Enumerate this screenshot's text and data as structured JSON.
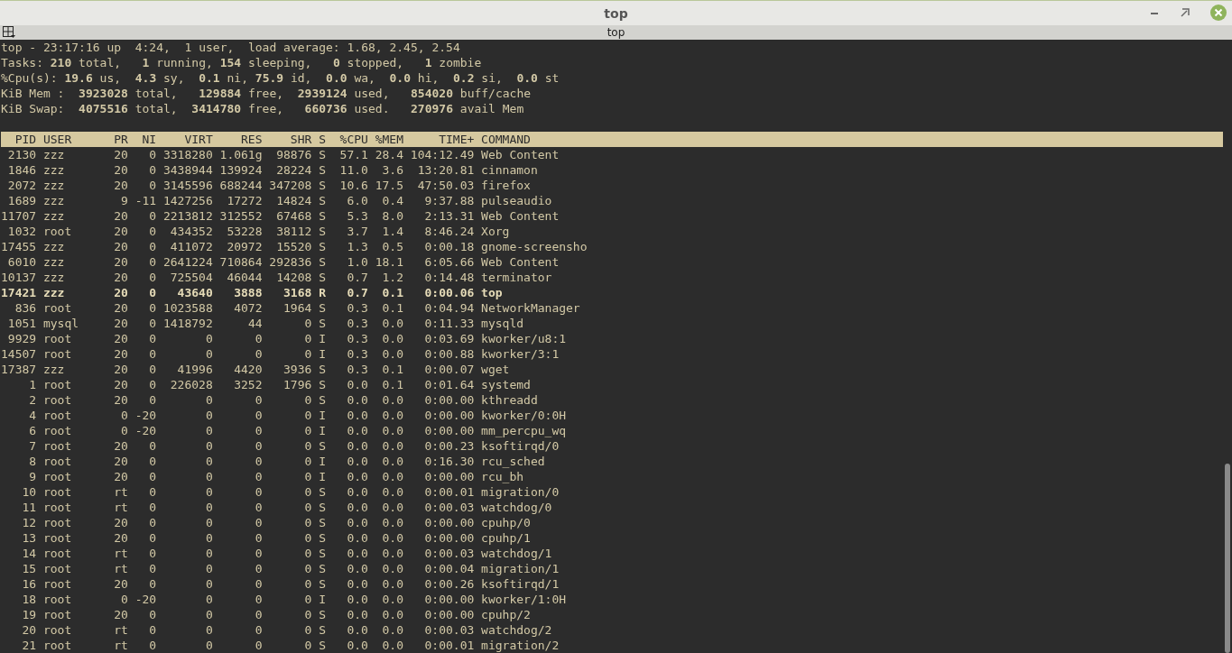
{
  "window": {
    "title": "top"
  },
  "tab": {
    "label": "top"
  },
  "summary": [
    "top - 23:17:16 up  4:24,  1 user,  load average: 1.68, 2.45, 2.54",
    "Tasks: **210** total,   **1** running, **154** sleeping,   **0** stopped,   **1** zombie",
    "%Cpu(s): **19.6** us,  **4.3** sy,  **0.1** ni, **75.9** id,  **0.0** wa,  **0.0** hi,  **0.2** si,  **0.0** st",
    "KiB Mem :  **3923028** total,   **129884** free,  **2939124** used,   **854020** buff/cache",
    "KiB Swap:  **4075516** total,  **3414780** free,   **660736** used.   **270976** avail Mem"
  ],
  "columns": [
    "PID",
    "USER",
    "PR",
    "NI",
    "VIRT",
    "RES",
    "SHR",
    "S",
    "%CPU",
    "%MEM",
    "TIME+",
    "COMMAND"
  ],
  "rows": [
    {
      "bold": false,
      "cells": [
        "2130",
        "zzz",
        "20",
        "0",
        "3318280",
        "1.061g",
        "98876",
        "S",
        "57.1",
        "28.4",
        "104:12.49",
        "Web Content"
      ]
    },
    {
      "bold": false,
      "cells": [
        "1846",
        "zzz",
        "20",
        "0",
        "3438944",
        "139924",
        "28224",
        "S",
        "11.0",
        "3.6",
        "13:20.81",
        "cinnamon"
      ]
    },
    {
      "bold": false,
      "cells": [
        "2072",
        "zzz",
        "20",
        "0",
        "3145596",
        "688244",
        "347208",
        "S",
        "10.6",
        "17.5",
        "47:50.03",
        "firefox"
      ]
    },
    {
      "bold": false,
      "cells": [
        "1689",
        "zzz",
        "9",
        "-11",
        "1427256",
        "17272",
        "14824",
        "S",
        "6.0",
        "0.4",
        "9:37.88",
        "pulseaudio"
      ]
    },
    {
      "bold": false,
      "cells": [
        "11707",
        "zzz",
        "20",
        "0",
        "2213812",
        "312552",
        "67468",
        "S",
        "5.3",
        "8.0",
        "2:13.31",
        "Web Content"
      ]
    },
    {
      "bold": false,
      "cells": [
        "1032",
        "root",
        "20",
        "0",
        "434352",
        "53228",
        "38112",
        "S",
        "3.7",
        "1.4",
        "8:46.24",
        "Xorg"
      ]
    },
    {
      "bold": false,
      "cells": [
        "17455",
        "zzz",
        "20",
        "0",
        "411072",
        "20972",
        "15520",
        "S",
        "1.3",
        "0.5",
        "0:00.18",
        "gnome-screensho"
      ]
    },
    {
      "bold": false,
      "cells": [
        "6010",
        "zzz",
        "20",
        "0",
        "2641224",
        "710864",
        "292836",
        "S",
        "1.0",
        "18.1",
        "6:05.66",
        "Web Content"
      ]
    },
    {
      "bold": false,
      "cells": [
        "10137",
        "zzz",
        "20",
        "0",
        "725504",
        "46044",
        "14208",
        "S",
        "0.7",
        "1.2",
        "0:14.48",
        "terminator"
      ]
    },
    {
      "bold": true,
      "cells": [
        "17421",
        "zzz",
        "20",
        "0",
        "43640",
        "3888",
        "3168",
        "R",
        "0.7",
        "0.1",
        "0:00.06",
        "top"
      ]
    },
    {
      "bold": false,
      "cells": [
        "836",
        "root",
        "20",
        "0",
        "1023588",
        "4072",
        "1964",
        "S",
        "0.3",
        "0.1",
        "0:04.94",
        "NetworkManager"
      ]
    },
    {
      "bold": false,
      "cells": [
        "1051",
        "mysql",
        "20",
        "0",
        "1418792",
        "44",
        "0",
        "S",
        "0.3",
        "0.0",
        "0:11.33",
        "mysqld"
      ]
    },
    {
      "bold": false,
      "cells": [
        "9929",
        "root",
        "20",
        "0",
        "0",
        "0",
        "0",
        "I",
        "0.3",
        "0.0",
        "0:03.69",
        "kworker/u8:1"
      ]
    },
    {
      "bold": false,
      "cells": [
        "14507",
        "root",
        "20",
        "0",
        "0",
        "0",
        "0",
        "I",
        "0.3",
        "0.0",
        "0:00.88",
        "kworker/3:1"
      ]
    },
    {
      "bold": false,
      "cells": [
        "17387",
        "zzz",
        "20",
        "0",
        "41996",
        "4420",
        "3936",
        "S",
        "0.3",
        "0.1",
        "0:00.07",
        "wget"
      ]
    },
    {
      "bold": false,
      "cells": [
        "1",
        "root",
        "20",
        "0",
        "226028",
        "3252",
        "1796",
        "S",
        "0.0",
        "0.1",
        "0:01.64",
        "systemd"
      ]
    },
    {
      "bold": false,
      "cells": [
        "2",
        "root",
        "20",
        "0",
        "0",
        "0",
        "0",
        "S",
        "0.0",
        "0.0",
        "0:00.00",
        "kthreadd"
      ]
    },
    {
      "bold": false,
      "cells": [
        "4",
        "root",
        "0",
        "-20",
        "0",
        "0",
        "0",
        "I",
        "0.0",
        "0.0",
        "0:00.00",
        "kworker/0:0H"
      ]
    },
    {
      "bold": false,
      "cells": [
        "6",
        "root",
        "0",
        "-20",
        "0",
        "0",
        "0",
        "I",
        "0.0",
        "0.0",
        "0:00.00",
        "mm_percpu_wq"
      ]
    },
    {
      "bold": false,
      "cells": [
        "7",
        "root",
        "20",
        "0",
        "0",
        "0",
        "0",
        "S",
        "0.0",
        "0.0",
        "0:00.23",
        "ksoftirqd/0"
      ]
    },
    {
      "bold": false,
      "cells": [
        "8",
        "root",
        "20",
        "0",
        "0",
        "0",
        "0",
        "I",
        "0.0",
        "0.0",
        "0:16.30",
        "rcu_sched"
      ]
    },
    {
      "bold": false,
      "cells": [
        "9",
        "root",
        "20",
        "0",
        "0",
        "0",
        "0",
        "I",
        "0.0",
        "0.0",
        "0:00.00",
        "rcu_bh"
      ]
    },
    {
      "bold": false,
      "cells": [
        "10",
        "root",
        "rt",
        "0",
        "0",
        "0",
        "0",
        "S",
        "0.0",
        "0.0",
        "0:00.01",
        "migration/0"
      ]
    },
    {
      "bold": false,
      "cells": [
        "11",
        "root",
        "rt",
        "0",
        "0",
        "0",
        "0",
        "S",
        "0.0",
        "0.0",
        "0:00.03",
        "watchdog/0"
      ]
    },
    {
      "bold": false,
      "cells": [
        "12",
        "root",
        "20",
        "0",
        "0",
        "0",
        "0",
        "S",
        "0.0",
        "0.0",
        "0:00.00",
        "cpuhp/0"
      ]
    },
    {
      "bold": false,
      "cells": [
        "13",
        "root",
        "20",
        "0",
        "0",
        "0",
        "0",
        "S",
        "0.0",
        "0.0",
        "0:00.00",
        "cpuhp/1"
      ]
    },
    {
      "bold": false,
      "cells": [
        "14",
        "root",
        "rt",
        "0",
        "0",
        "0",
        "0",
        "S",
        "0.0",
        "0.0",
        "0:00.03",
        "watchdog/1"
      ]
    },
    {
      "bold": false,
      "cells": [
        "15",
        "root",
        "rt",
        "0",
        "0",
        "0",
        "0",
        "S",
        "0.0",
        "0.0",
        "0:00.04",
        "migration/1"
      ]
    },
    {
      "bold": false,
      "cells": [
        "16",
        "root",
        "20",
        "0",
        "0",
        "0",
        "0",
        "S",
        "0.0",
        "0.0",
        "0:00.26",
        "ksoftirqd/1"
      ]
    },
    {
      "bold": false,
      "cells": [
        "18",
        "root",
        "0",
        "-20",
        "0",
        "0",
        "0",
        "I",
        "0.0",
        "0.0",
        "0:00.00",
        "kworker/1:0H"
      ]
    },
    {
      "bold": false,
      "cells": [
        "19",
        "root",
        "20",
        "0",
        "0",
        "0",
        "0",
        "S",
        "0.0",
        "0.0",
        "0:00.00",
        "cpuhp/2"
      ]
    },
    {
      "bold": false,
      "cells": [
        "20",
        "root",
        "rt",
        "0",
        "0",
        "0",
        "0",
        "S",
        "0.0",
        "0.0",
        "0:00.03",
        "watchdog/2"
      ]
    },
    {
      "bold": false,
      "cells": [
        "21",
        "root",
        "rt",
        "0",
        "0",
        "0",
        "0",
        "S",
        "0.0",
        "0.0",
        "0:00.01",
        "migration/2"
      ]
    }
  ]
}
